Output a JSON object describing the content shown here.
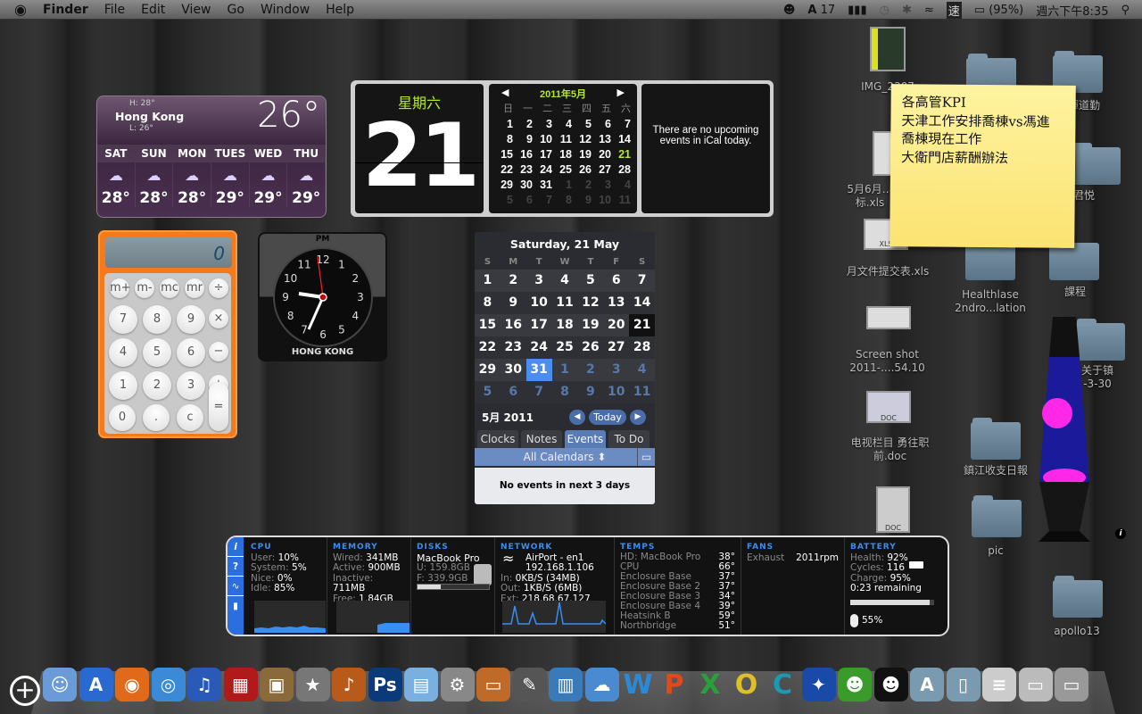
{
  "menubar": {
    "apple": "",
    "items": [
      "Finder",
      "File",
      "Edit",
      "View",
      "Go",
      "Window",
      "Help"
    ],
    "status": {
      "adobe_count": "17",
      "battery_pct": "(95%)",
      "input_method": "速",
      "clock": "週六下午8:35"
    }
  },
  "weather": {
    "city": "Hong Kong",
    "high": "H: 28°",
    "low": "L: 26°",
    "current": "26°",
    "days": [
      {
        "d": "SAT",
        "t": "28°"
      },
      {
        "d": "SUN",
        "t": "28°"
      },
      {
        "d": "MON",
        "t": "28°"
      },
      {
        "d": "TUES",
        "t": "29°"
      },
      {
        "d": "WED",
        "t": "29°"
      },
      {
        "d": "THU",
        "t": "29°"
      }
    ],
    "icon": "thunderstorm-icon"
  },
  "calculator": {
    "display": "0",
    "keys": [
      "m+",
      "m-",
      "mc",
      "mr",
      "÷",
      "7",
      "8",
      "9",
      "×",
      "4",
      "5",
      "6",
      "−",
      "1",
      "2",
      "3",
      "+",
      "0",
      ".",
      "c",
      "="
    ]
  },
  "clock": {
    "ampm": "PM",
    "city": "HONG KONG",
    "time": "8:35",
    "numbers": [
      "12",
      "1",
      "2",
      "3",
      "4",
      "5",
      "6",
      "7",
      "8",
      "9",
      "10",
      "11"
    ]
  },
  "ical": {
    "weekday": "星期六",
    "day": "21",
    "month_title": "2011年5月",
    "weekdays": [
      "日",
      "一",
      "二",
      "三",
      "四",
      "五",
      "六"
    ],
    "days": [
      "1",
      "2",
      "3",
      "4",
      "5",
      "6",
      "7",
      "8",
      "9",
      "10",
      "11",
      "12",
      "13",
      "14",
      "15",
      "16",
      "17",
      "18",
      "19",
      "20",
      "21",
      "22",
      "23",
      "24",
      "25",
      "26",
      "27",
      "28",
      "29",
      "30",
      "31",
      "1",
      "2",
      "3",
      "4",
      "5",
      "6",
      "7",
      "8",
      "9",
      "10",
      "11"
    ],
    "today_index": 20,
    "current_month_count": 31,
    "no_events": "There are no upcoming events in iCal today.",
    "accent": "#b6e82a"
  },
  "calwidget": {
    "title": "Saturday, 21 May",
    "weekdays": [
      "S",
      "M",
      "T",
      "W",
      "T",
      "F",
      "S"
    ],
    "days": [
      "1",
      "2",
      "3",
      "4",
      "5",
      "6",
      "7",
      "8",
      "9",
      "10",
      "11",
      "12",
      "13",
      "14",
      "15",
      "16",
      "17",
      "18",
      "19",
      "20",
      "21",
      "22",
      "23",
      "24",
      "25",
      "26",
      "27",
      "28",
      "29",
      "30",
      "31",
      "1",
      "2",
      "3",
      "4",
      "5",
      "6",
      "7",
      "8",
      "9",
      "10",
      "11"
    ],
    "today_index": 20,
    "selected_index": 30,
    "month_label": "5月 2011",
    "today_btn": "Today",
    "tabs": [
      "Clocks",
      "Notes",
      "Events",
      "To Do"
    ],
    "active_tab": "Events",
    "calendars": "All Calendars ⬍",
    "no_events": "No events in next 3 days",
    "accent": "#4a8ef0"
  },
  "istat": {
    "cpu": {
      "h": "CPU",
      "rows": [
        [
          "User: ",
          "10%"
        ],
        [
          "System: ",
          "5%"
        ],
        [
          "Nice: ",
          "0%"
        ],
        [
          "Idle: ",
          "85%"
        ]
      ]
    },
    "memory": {
      "h": "MEMORY",
      "rows": [
        [
          "Wired: ",
          "341MB"
        ],
        [
          "Active: ",
          "900MB"
        ],
        [
          "Inactive: ",
          "711MB"
        ],
        [
          "Free: ",
          "1.84GB"
        ]
      ]
    },
    "disks": {
      "h": "DISKS",
      "name": "MacBook Pro",
      "used": "U: 159.8GB",
      "free": "F: 339.9GB",
      "used_fraction": 0.32
    },
    "network": {
      "h": "NETWORK",
      "iface": "AirPort - en1",
      "ip": "192.168.1.106",
      "in": [
        "In: ",
        "0KB/S (34MB)"
      ],
      "out": [
        "Out: ",
        "1KB/S (6MB)"
      ],
      "ext": [
        "Ext: ",
        "218.68.67.127"
      ]
    },
    "temps": {
      "h": "TEMPS",
      "rows": [
        [
          "HD: MacBook Pro",
          "38°"
        ],
        [
          "CPU",
          "66°"
        ],
        [
          "Enclosure Base",
          "37°"
        ],
        [
          "Enclosure Base 2",
          "37°"
        ],
        [
          "Enclosure Base 3",
          "34°"
        ],
        [
          "Enclosure Base 4",
          "39°"
        ],
        [
          "Heatsink B",
          "59°"
        ],
        [
          "Northbridge",
          "51°"
        ]
      ]
    },
    "fans": {
      "h": "FANS",
      "rows": [
        [
          "Exhaust",
          "2011rpm"
        ]
      ]
    },
    "battery": {
      "h": "BATTERY",
      "health": [
        "Health: ",
        "92%"
      ],
      "cycles": [
        "Cycles: ",
        "116"
      ],
      "charge": [
        "Charge: ",
        "95%"
      ],
      "remaining": "0:23 remaining",
      "charge_fraction": 0.95,
      "mouse": "55%"
    },
    "side_buttons": [
      "i",
      "?",
      "pulse-icon",
      "battery-icon"
    ]
  },
  "sticky": {
    "lines": [
      "各高管KPI",
      "天津工作安排喬棟vs馮進",
      "喬棟現在工作",
      "大衛門店薪酬辦法"
    ]
  },
  "desktop": {
    "icons": [
      "IMG_2307",
      "5月6月…标.xls",
      "月文件提交表.xls",
      "Screen shot 2011-....54.10",
      "电视栏目 勇往职前.doc",
      "Healthlase 2ndro...lation",
      "鎮江收支日報",
      "pic",
      "輝道勤",
      "君悦",
      "課程",
      "关于镇 -3-30",
      "apollo13"
    ],
    "thumb_labels": [
      "XLS",
      "XLS",
      "DOC",
      "DOC"
    ]
  },
  "dock": {
    "items": [
      "Finder",
      "App Store",
      "Firefox",
      "Safari",
      "iTunes",
      "Front Row",
      "iPhoto",
      "iMovie",
      "GarageBand",
      "Photoshop",
      "Preview",
      "System Preferences",
      "Keynote",
      "Script Editor",
      "Numbers",
      "OpenOffice",
      "Word",
      "PowerPoint",
      "Excel",
      "Outlook",
      "Communicator",
      "Adium",
      "QQ",
      "Applications",
      "Documents",
      "Text",
      "Firefox window",
      "Word window",
      "Trash"
    ]
  },
  "lavalamp": {
    "info": "i",
    "blob_color": "#ff28e8"
  }
}
